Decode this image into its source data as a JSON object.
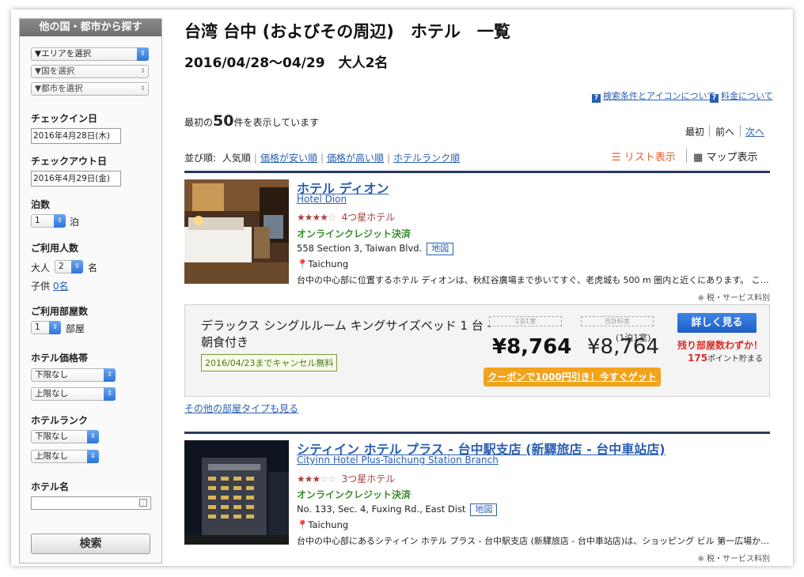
{
  "sidebar": {
    "header": "他の国・都市から探す",
    "area_select": "▼エリアを選択",
    "country_select": "▼国を選択",
    "city_select": "▼都市を選択",
    "checkin_label": "チェックイン日",
    "checkin_value": "2016年4月28日(木)",
    "checkout_label": "チェックアウト日",
    "checkout_value": "2016年4月29日(金)",
    "nights_label": "泊数",
    "nights_value": "1",
    "nights_unit": "泊",
    "guests_label": "ご利用人数",
    "adults_label": "大人",
    "adults_value": "2",
    "adults_unit": "名",
    "children_label": "子供",
    "children_value": "0名",
    "rooms_label": "ご利用部屋数",
    "rooms_value": "1",
    "rooms_unit": "部屋",
    "price_label": "ホテル価格帯",
    "price_min": "下限なし",
    "price_max": "上限なし",
    "rank_label": "ホテルランク",
    "rank_min": "下限なし",
    "rank_max": "上限なし",
    "hotelname_label": "ホテル名",
    "hotelname_value": "",
    "search_button": "検索"
  },
  "header": {
    "title": "台湾 台中 (およびその周辺)　ホテル　一覧",
    "subtitle": "2016/04/28〜04/29　大人2名",
    "help_conditions": "検索条件とアイコンについて",
    "help_price": "料金について"
  },
  "results": {
    "count_prefix": "最初の",
    "count_number": "50",
    "count_suffix": "件を表示しています",
    "pager_first": "最初",
    "pager_prev": "前へ",
    "pager_next": "次へ"
  },
  "sort": {
    "label": "並び順:",
    "popular": "人気順",
    "price_low": "価格が安い順",
    "price_high": "価格が高い順",
    "rank": "ホテルランク順"
  },
  "view": {
    "list": "リスト表示",
    "map": "マップ表示"
  },
  "hotels": [
    {
      "name": "ホテル ディオン",
      "name_en": "Hotel Dion",
      "stars": "★★★★",
      "stars_empty": "☆",
      "rank_text": "4つ星ホテル",
      "payment": "オンラインクレジット決済",
      "address": "558 Section 3, Taiwan Blvd.",
      "map_label": "地図",
      "city": "Taichung",
      "description": "台中の中心部に位置するホテル ディオンは、秋紅谷廣場まで歩いてすぐ、老虎城も 500 m 圏内と近くにあります。 こ…",
      "tax_note": "※ 税・サービス料別",
      "room": {
        "name": "デラックス シングルルーム キングサイズベッド 1 台 - 朝食付き",
        "cancel": "2016/04/23までキャンセル無料",
        "label_night": "1泊1室",
        "label_total": "合計料金",
        "price_per": "¥8,764",
        "price_total": "¥8,764",
        "per_night_note": "(1泊1室)",
        "coupon": "クーポンで1000円引き！今すぐゲット",
        "detail_button": "詳しく見る",
        "remaining": "残り部屋数わずか！",
        "points_value": "175",
        "points_suffix": "ポイント貯まる"
      },
      "other_rooms": "その他の部屋タイプも見る"
    },
    {
      "name": "シティイン ホテル プラス - 台中駅支店 (新驛旅店 - 台中車站店)",
      "name_en": "Cityinn Hotel Plus-Taichung Station Branch",
      "stars": "★★★",
      "stars_empty": "☆☆",
      "rank_text": "3つ星ホテル",
      "payment": "オンラインクレジット決済",
      "address": "No. 133, Sec. 4, Fuxing Rd., East Dist",
      "map_label": "地図",
      "city": "Taichung",
      "description": "台中の中心部にあるシティイン ホテル プラス - 台中駅支店 (新驛旅店 - 台中車站店)は、ショッピング ビル 第一広場か…",
      "tax_note": "※ 税・サービス料別"
    }
  ],
  "colors": {
    "link": "#2b5fb0",
    "star": "#b23b3b",
    "online": "#3a8a2a",
    "coupon": "#f2a31c",
    "detail_button": "#2f74d9",
    "alert": "#d6302a",
    "rule": "#283a5e"
  }
}
